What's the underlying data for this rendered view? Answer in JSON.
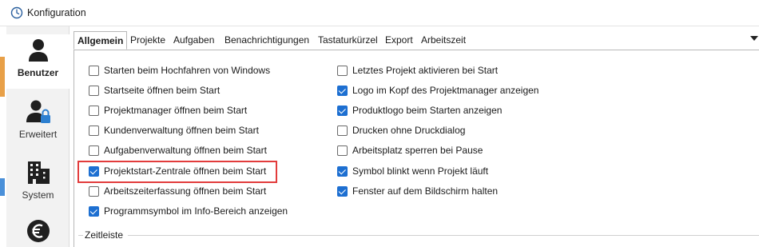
{
  "window": {
    "title": "Konfiguration"
  },
  "sidebar": {
    "items": [
      {
        "label": "Benutzer",
        "icon": "user-icon",
        "active": true
      },
      {
        "label": "Erweitert",
        "icon": "user-lock-icon",
        "active": false
      },
      {
        "label": "System",
        "icon": "building-icon",
        "active": false
      },
      {
        "label": "",
        "icon": "euro-icon",
        "active": false
      }
    ]
  },
  "tabs": [
    {
      "label": "Allgemein",
      "active": true
    },
    {
      "label": "Projekte"
    },
    {
      "label": "Aufgaben"
    },
    {
      "label": "Benachrichtigungen"
    },
    {
      "label": "Tastaturkürzel"
    },
    {
      "label": "Export"
    },
    {
      "label": "Arbeitszeit"
    }
  ],
  "options_left": [
    {
      "label": "Starten beim Hochfahren von Windows",
      "checked": false
    },
    {
      "label": "Startseite öffnen beim Start",
      "checked": false
    },
    {
      "label": "Projektmanager öffnen beim Start",
      "checked": false
    },
    {
      "label": "Kundenverwaltung öffnen beim Start",
      "checked": false
    },
    {
      "label": "Aufgabenverwaltung öffnen beim Start",
      "checked": false
    },
    {
      "label": "Projektstart-Zentrale öffnen beim Start",
      "checked": true
    },
    {
      "label": "Arbeitszeiterfassung öffnen beim Start",
      "checked": false
    },
    {
      "label": "Programmsymbol im Info-Bereich anzeigen",
      "checked": true
    }
  ],
  "options_right": [
    {
      "label": "Letztes Projekt aktivieren bei Start",
      "checked": false
    },
    {
      "label": "Logo im Kopf des Projektmanager anzeigen",
      "checked": true
    },
    {
      "label": "Produktlogo beim Starten anzeigen",
      "checked": true
    },
    {
      "label": "Drucken ohne Druckdialog",
      "checked": false
    },
    {
      "label": "Arbeitsplatz sperren bei Pause",
      "checked": false
    },
    {
      "label": "Symbol blinkt wenn Projekt läuft",
      "checked": true
    },
    {
      "label": "Fenster auf dem Bildschirm halten",
      "checked": true
    }
  ],
  "group": {
    "label": "Zeitleiste"
  },
  "colors": {
    "accent": "#1d6fd1",
    "highlight": "#e23c3c"
  }
}
